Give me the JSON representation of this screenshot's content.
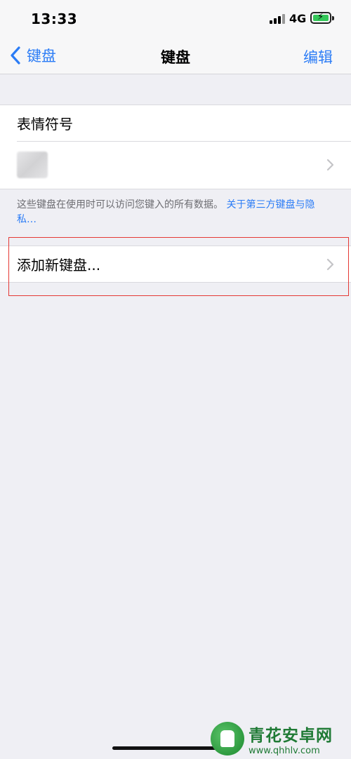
{
  "status_bar": {
    "time": "13:33",
    "network": "4G"
  },
  "nav": {
    "back_label": "键盘",
    "title": "键盘",
    "edit_label": "编辑"
  },
  "keyboards": {
    "items": [
      {
        "label": "表情符号"
      },
      {
        "label": ""
      }
    ]
  },
  "footer": {
    "text": "这些键盘在使用时可以访问您键入的所有数据。",
    "link": "关于第三方键盘与隐私…"
  },
  "add_keyboard": {
    "label": "添加新键盘..."
  },
  "watermark": {
    "name": "青花安卓网",
    "url": "www.qhhlv.com"
  },
  "colors": {
    "accent": "#2b7cf6",
    "background": "#efeff4",
    "highlight": "#e53935"
  },
  "icons": {
    "back": "chevron-left-icon",
    "disclosure": "chevron-right-icon"
  }
}
